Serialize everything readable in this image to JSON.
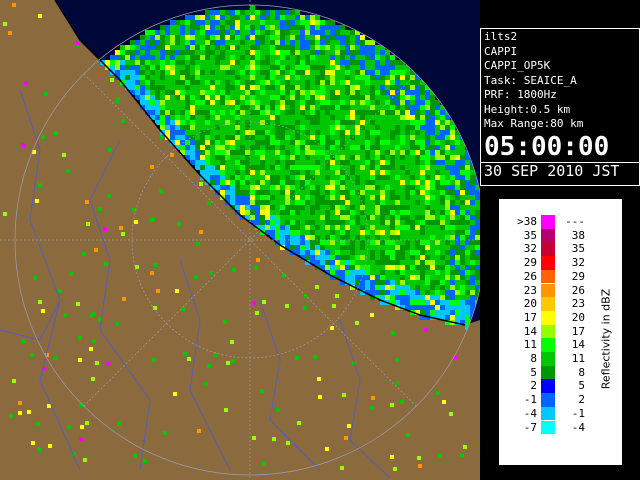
{
  "info": {
    "site": "ilts2",
    "product": "CAPPI",
    "product_code": "CAPPI_OP5K",
    "task": "Task: SEAICE_A",
    "prf": "PRF: 1800Hz",
    "height": "Height:0.5 km",
    "max_range": "Max Range:80 km",
    "time": "05:00:00",
    "date": "30 SEP 2010 JST"
  },
  "legend": {
    "unit": "Reflectivity in dBZ",
    "rows": [
      {
        "lo": ">38",
        "hi": "---",
        "color": "#ff00ff"
      },
      {
        "lo": "35",
        "hi": "38",
        "color": "#b4006e"
      },
      {
        "lo": "32",
        "hi": "35",
        "color": "#c80032"
      },
      {
        "lo": "29",
        "hi": "32",
        "color": "#ff0000"
      },
      {
        "lo": "26",
        "hi": "29",
        "color": "#ff6400"
      },
      {
        "lo": "23",
        "hi": "26",
        "color": "#ff9600"
      },
      {
        "lo": "20",
        "hi": "23",
        "color": "#ffc800"
      },
      {
        "lo": "17",
        "hi": "20",
        "color": "#ffff00"
      },
      {
        "lo": "14",
        "hi": "17",
        "color": "#96ff00"
      },
      {
        "lo": "11",
        "hi": "14",
        "color": "#00ff00"
      },
      {
        "lo": "8",
        "hi": "11",
        "color": "#00c800"
      },
      {
        "lo": "5",
        "hi": "8",
        "color": "#009600"
      },
      {
        "lo": "2",
        "hi": "5",
        "color": "#0000ff"
      },
      {
        "lo": "-1",
        "hi": "2",
        "color": "#0064ff"
      },
      {
        "lo": "-4",
        "hi": "-1",
        "color": "#00c8ff"
      },
      {
        "lo": "-7",
        "hi": "-4",
        "color": "#00ffff"
      }
    ]
  },
  "colors": {
    "land": "#8b6a3e",
    "sea_bg": "#000a3a",
    "rivers": "#4a5bd8",
    "range_ring": "#9aa0b0"
  }
}
